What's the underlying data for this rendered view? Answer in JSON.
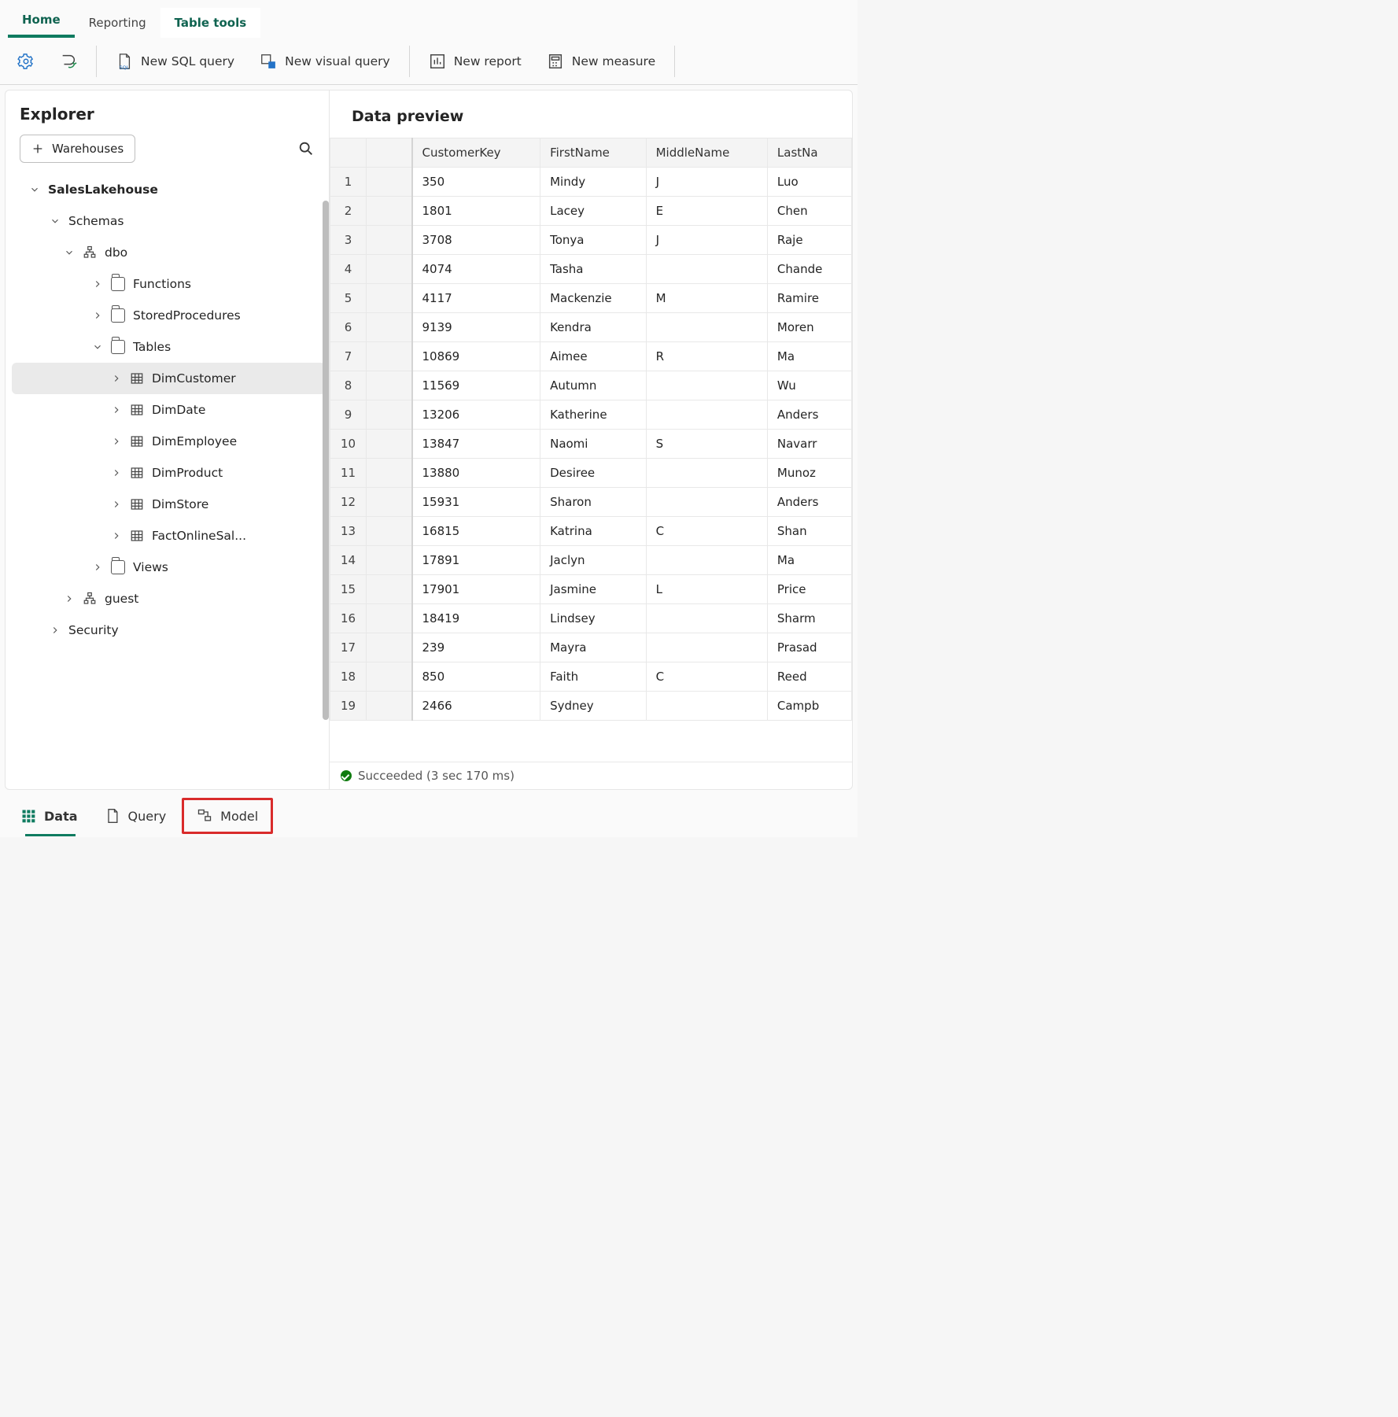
{
  "tabs": {
    "home": "Home",
    "reporting": "Reporting",
    "tabletools": "Table tools"
  },
  "cmd": {
    "new_sql": "New SQL query",
    "new_visual": "New visual query",
    "new_report": "New report",
    "new_measure": "New measure"
  },
  "explorer": {
    "title": "Explorer",
    "warehouses_btn": "Warehouses",
    "nodes": {
      "root": "SalesLakehouse",
      "schemas": "Schemas",
      "dbo": "dbo",
      "functions": "Functions",
      "sprocs": "StoredProcedures",
      "tables": "Tables",
      "t1": "DimCustomer",
      "t2": "DimDate",
      "t3": "DimEmployee",
      "t4": "DimProduct",
      "t5": "DimStore",
      "t6": "FactOnlineSal...",
      "views": "Views",
      "guest": "guest",
      "security": "Security"
    }
  },
  "preview": {
    "title": "Data preview",
    "columns": [
      "",
      "",
      "CustomerKey",
      "FirstName",
      "MiddleName",
      "LastNa"
    ],
    "rows": [
      [
        "1",
        "",
        "350",
        "Mindy",
        "J",
        "Luo"
      ],
      [
        "2",
        "",
        "1801",
        "Lacey",
        "E",
        "Chen"
      ],
      [
        "3",
        "",
        "3708",
        "Tonya",
        "J",
        "Raje"
      ],
      [
        "4",
        "",
        "4074",
        "Tasha",
        "",
        "Chande"
      ],
      [
        "5",
        "",
        "4117",
        "Mackenzie",
        "M",
        "Ramire"
      ],
      [
        "6",
        "",
        "9139",
        "Kendra",
        "",
        "Moren"
      ],
      [
        "7",
        "",
        "10869",
        "Aimee",
        "R",
        "Ma"
      ],
      [
        "8",
        "",
        "11569",
        "Autumn",
        "",
        "Wu"
      ],
      [
        "9",
        "",
        "13206",
        "Katherine",
        "",
        "Anders"
      ],
      [
        "10",
        "",
        "13847",
        "Naomi",
        "S",
        "Navarr"
      ],
      [
        "11",
        "",
        "13880",
        "Desiree",
        "",
        "Munoz"
      ],
      [
        "12",
        "",
        "15931",
        "Sharon",
        "",
        "Anders"
      ],
      [
        "13",
        "",
        "16815",
        "Katrina",
        "C",
        "Shan"
      ],
      [
        "14",
        "",
        "17891",
        "Jaclyn",
        "",
        "Ma"
      ],
      [
        "15",
        "",
        "17901",
        "Jasmine",
        "L",
        "Price"
      ],
      [
        "16",
        "",
        "18419",
        "Lindsey",
        "",
        "Sharm"
      ],
      [
        "17",
        "",
        "239",
        "Mayra",
        "",
        "Prasad"
      ],
      [
        "18",
        "",
        "850",
        "Faith",
        "C",
        "Reed"
      ],
      [
        "19",
        "",
        "2466",
        "Sydney",
        "",
        "Campb"
      ]
    ],
    "status": "Succeeded (3 sec 170 ms)"
  },
  "btabs": {
    "data": "Data",
    "query": "Query",
    "model": "Model"
  }
}
